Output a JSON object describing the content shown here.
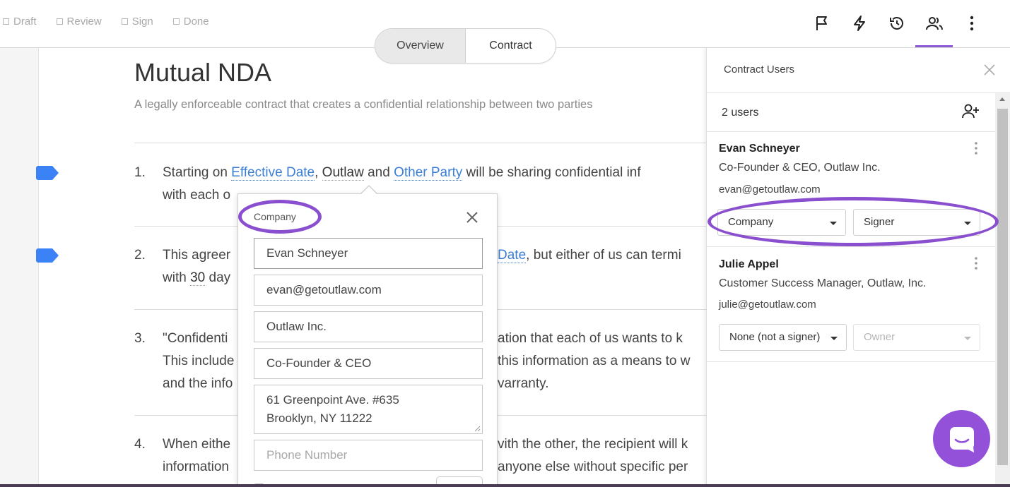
{
  "workflow_steps": [
    "Draft",
    "Review",
    "Sign",
    "Done"
  ],
  "top_icons": [
    "flag-icon",
    "lightning-icon",
    "history-icon",
    "users-icon",
    "more-vertical-icon"
  ],
  "view_toggle": {
    "overview": "Overview",
    "contract": "Contract"
  },
  "document": {
    "title": "Mutual NDA",
    "subtitle": "A legally enforceable contract that creates a confidential relationship between two parties",
    "clauses": [
      {
        "num": "1.",
        "pre": "Starting on ",
        "var1": "Effective Date",
        "sep": ", ",
        "var2": "Outlaw",
        "mid": " and ",
        "var3": "Other Party",
        "post": " will be sharing confidential inf",
        "line2": "with each o"
      },
      {
        "num": "2.",
        "pre": "This agreer",
        "var1": "Date",
        "post": ", but either of us can termi",
        "line2_pre": "with ",
        "line2_var": "30",
        "line2_post": " day"
      },
      {
        "num": "3.",
        "line1_a": "\"Confidenti",
        "line1_b": "ation that each of us wants to k",
        "line2_a": "This include",
        "line2_b": "this information as a means to w",
        "line3_a": "and the info",
        "line3_b": "varranty."
      },
      {
        "num": "4.",
        "line1_a": "When eithe",
        "line1_b": "vith the other, the recipient will k",
        "line2_a": "information",
        "line2_b": "anyone else without specific per"
      }
    ]
  },
  "popover": {
    "label": "Company",
    "name": "Evan Schneyer",
    "email": "evan@getoutlaw.com",
    "company": "Outlaw Inc.",
    "role": "Co-Founder & CEO",
    "address_line1": "61 Greenpoint Ave. #635",
    "address_line2": "Brooklyn, NY 11222",
    "phone_placeholder": "Phone Number"
  },
  "panel": {
    "title": "Contract Users",
    "user_count": "2 users",
    "users": [
      {
        "name": "Evan Schneyer",
        "title": "Co-Founder & CEO, Outlaw Inc.",
        "email": "evan@getoutlaw.com",
        "party": "Company",
        "role": "Signer"
      },
      {
        "name": "Julie Appel",
        "title": "Customer Success Manager, Outlaw, Inc.",
        "email": "julie@getoutlaw.com",
        "party": "None (not a signer)",
        "role": "Owner"
      }
    ]
  },
  "colors": {
    "accent": "#8e5bd6",
    "link": "#3a7fd5",
    "flag": "#3b82f6",
    "annotation": "#8a4fcf"
  }
}
